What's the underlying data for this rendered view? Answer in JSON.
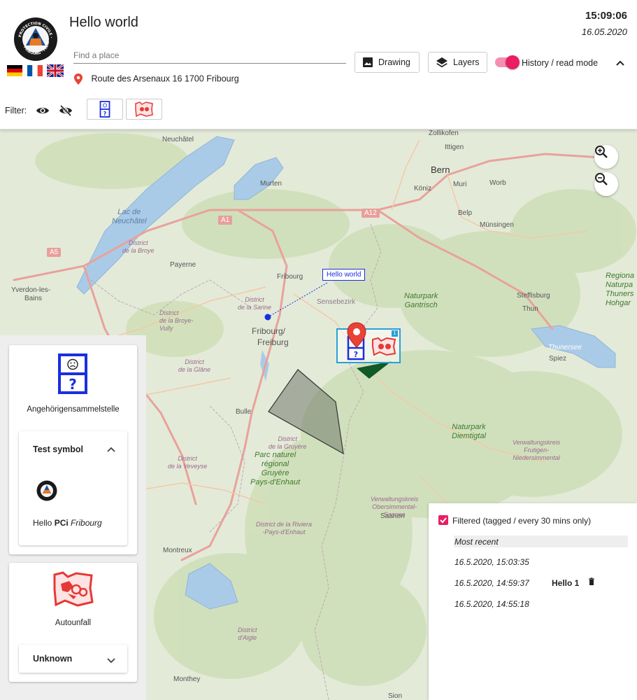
{
  "header": {
    "title": "Hello world",
    "time": "15:09:06",
    "date": "16.05.2020",
    "search_placeholder": "Find a place",
    "address": "Route des Arsenaux 16 1700 Fribourg",
    "languages": [
      "de",
      "fr",
      "en"
    ],
    "logo_text": "PROTECTION CIVILE · ZIVILSCHUTZ · FRIBOURG · FREIBURG"
  },
  "toolbar": {
    "drawing_label": "Drawing",
    "layers_label": "Layers",
    "history_label": "History / read mode",
    "history_on": true
  },
  "filter": {
    "label": "Filter:"
  },
  "map": {
    "labels": {
      "neuchatel": "Neuchâtel",
      "lac1": "Lac de",
      "lac2": "Neuchâtel",
      "murten": "Murten",
      "bern": "Bern",
      "zollikofen": "Zollikofen",
      "ittigen": "Ittigen",
      "koniz": "Köniz",
      "muri": "Muri",
      "worb": "Worb",
      "belp": "Belp",
      "munsingen": "Münsingen",
      "payerne": "Payerne",
      "fribourg": "Fribourg",
      "fribourg_big1": "Fribourg/",
      "fribourg_big2": "Freiburg",
      "sensebezirk": "Sensebezirk",
      "yverdon1": "Yverdon-les-",
      "yverdon2": "Bains",
      "bulle": "Bulle",
      "steffisburg": "Steffisburg",
      "thun": "Thun",
      "thunersee": "Thunersee",
      "spiez": "Spiez",
      "montreux": "Montreux",
      "monthey": "Monthey",
      "saanen": "Saanen",
      "sion": "Sion",
      "gantrisch1": "Naturpark",
      "gantrisch2": "Gantrisch",
      "diemtig1": "Naturpark",
      "diemtig2": "Diemtigtal",
      "gruyere1": "Parc naturel",
      "gruyere2": "régional",
      "gruyere3": "Gruyère",
      "gruyere4": "Pays-d'Enhaut",
      "thuner1": "Regiona",
      "thuner2": "Naturpa",
      "thuner3": "Thuners",
      "thuner4": "Hohgar",
      "d_broye": "District\nde la Broye",
      "d_sarine": "District\nde la Sarine",
      "d_glane": "District\nde la Glâne",
      "d_gruyere": "District\nde la Gruyère",
      "d_veveyse": "District\nde la Veveyse",
      "d_broye_vully": "District\nde la Broye-\nVully",
      "d_riviera": "District de la Riviera\n-Pays-d'Enhaut",
      "d_aigle": "District\nd'Aigle",
      "d_frutigen": "Verwaltungskreis\nFrutigen-\nNiedersimmental",
      "d_obersimmental": "Verwaltungskreis\nObersimmental-\nSaanen",
      "a1": "A1",
      "a5": "A5",
      "a12": "A12",
      "callout": "Hello world"
    }
  },
  "left_panel": {
    "card1_title": "Angehörigensammelstelle",
    "sub1_title": "Test symbol",
    "sub1_text_pre": "Hello ",
    "sub1_text_bold": "PCi",
    "sub1_text_italic": "Fribourg",
    "card2_title": "Autounfall",
    "sub2_title": "Unknown"
  },
  "history_panel": {
    "filter_label": "Filtered (tagged / every 30 mins only)",
    "filter_checked": true,
    "recent_label": "Most recent",
    "entries": [
      {
        "time": "16.5.2020, 15:03:35",
        "name": ""
      },
      {
        "time": "16.5.2020, 14:59:37",
        "name": "Hello 1"
      },
      {
        "time": "16.5.2020, 14:55:18",
        "name": ""
      }
    ]
  },
  "colors": {
    "accent": "#e91e63",
    "symbol_blue": "#1a2ee0",
    "symbol_red": "#e53935",
    "marker_red": "#ea4335"
  }
}
